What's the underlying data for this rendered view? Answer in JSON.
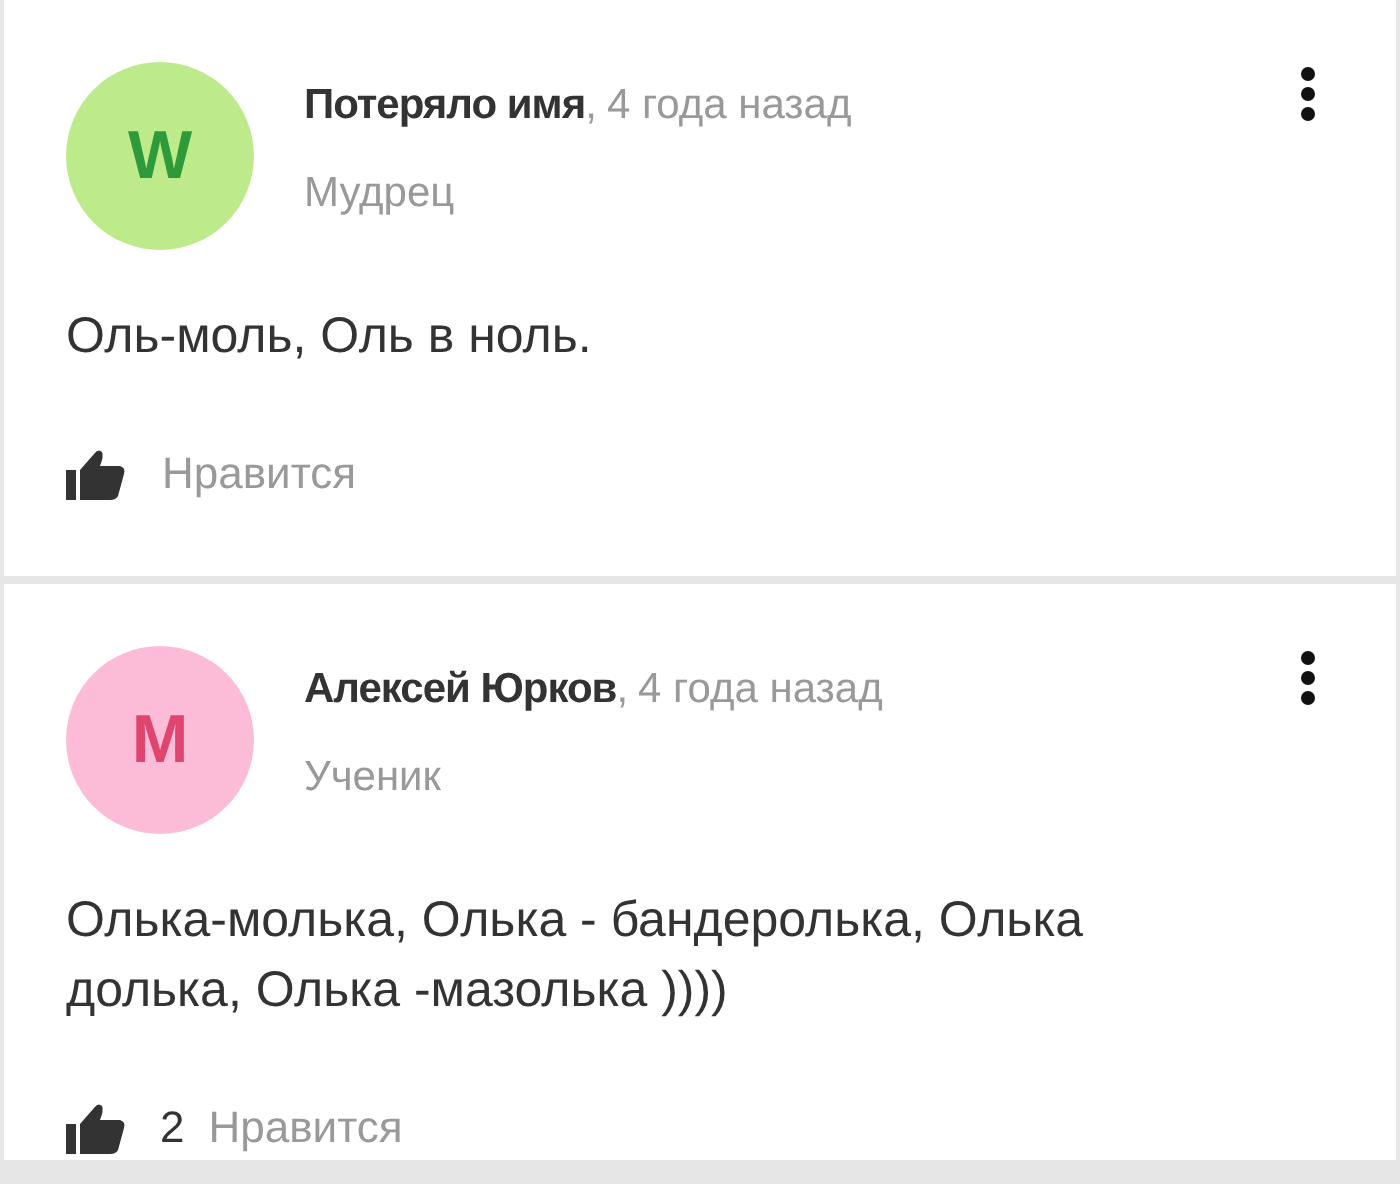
{
  "comments": [
    {
      "avatar": {
        "letter": "W",
        "color": "#bdeb8c"
      },
      "author": "Потеряло имя",
      "separator": ",",
      "time": "4 года назад",
      "rank": "Мудрец",
      "text": "Оль-моль, Оль в ноль.",
      "likes": {
        "label": "Нравится"
      }
    },
    {
      "avatar": {
        "letter": "M",
        "color": "#fcbcd8"
      },
      "author": "Алексей Юрков",
      "separator": ",",
      "time": "4 года назад",
      "rank": "Ученик",
      "text": "Олька-молька, Олька - бандеролька, Олька долька, Олька -мазолька ))))",
      "likes": {
        "count": "2",
        "label": "Нравится"
      }
    }
  ]
}
